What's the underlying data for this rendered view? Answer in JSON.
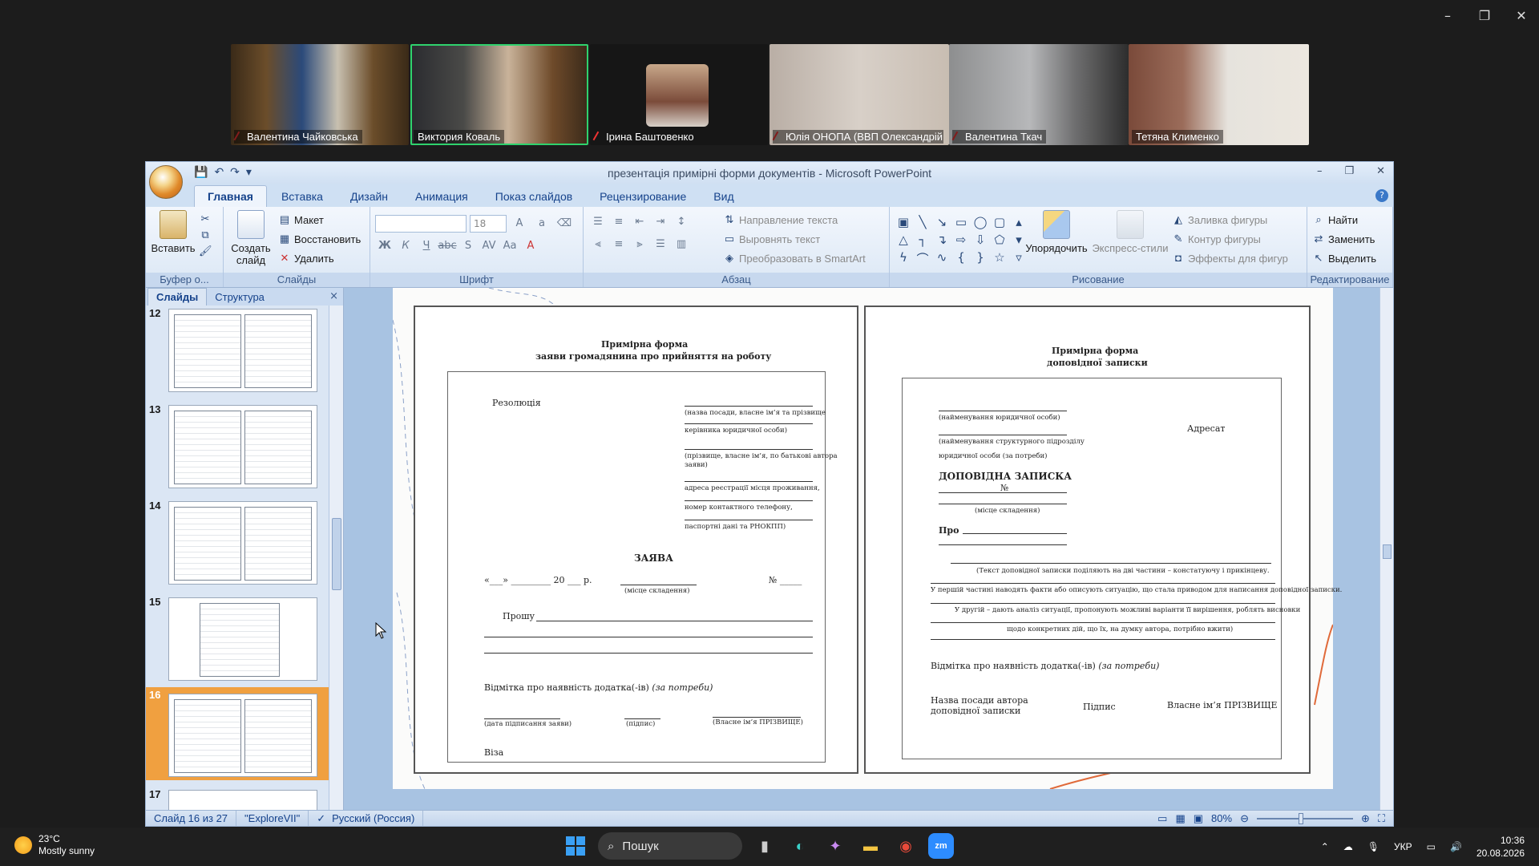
{
  "window_controls": {
    "minimize": "–",
    "restore": "❐",
    "close": "✕"
  },
  "participants": [
    {
      "name": "Валентина Чайковська",
      "muted": true,
      "active": false
    },
    {
      "name": "Виктория Коваль",
      "muted": false,
      "active": true
    },
    {
      "name": "Ірина Баштовенко",
      "muted": true,
      "active": false
    },
    {
      "name": "Юлія ОНОПА (ВВП Олександрій...",
      "muted": true,
      "active": false
    },
    {
      "name": "Валентина Ткач",
      "muted": true,
      "active": false
    },
    {
      "name": "Тетяна Клименко",
      "muted": false,
      "active": false
    }
  ],
  "ppt": {
    "title": "презентація примірні форми документів - Microsoft PowerPoint",
    "tabs": [
      "Главная",
      "Вставка",
      "Дизайн",
      "Анимация",
      "Показ слайдов",
      "Рецензирование",
      "Вид"
    ],
    "active_tab": "Главная",
    "ribbon": {
      "clipboard": {
        "paste": "Вставить",
        "label": "Буфер о..."
      },
      "slides": {
        "new_slide_1": "Создать",
        "new_slide_2": "слайд",
        "layout": "Макет",
        "reset": "Восстановить",
        "delete": "Удалить",
        "label": "Слайды"
      },
      "font": {
        "size": "18",
        "label": "Шрифт"
      },
      "paragraph": {
        "text_direction": "Направление текста",
        "align_text": "Выровнять текст",
        "smartart": "Преобразовать в SmartArt",
        "label": "Абзац"
      },
      "drawing": {
        "arrange": "Упорядочить",
        "quick_styles": "Экспресс-стили",
        "fill": "Заливка фигуры",
        "outline": "Контур фигуры",
        "effects": "Эффекты для фигур",
        "label": "Рисование"
      },
      "editing": {
        "find": "Найти",
        "replace": "Заменить",
        "select": "Выделить",
        "label": "Редактирование"
      }
    },
    "panel": {
      "tab_slides": "Слайды",
      "tab_outline": "Структура",
      "close": "×"
    },
    "slide_thumbs": [
      "12",
      "13",
      "14",
      "15",
      "16",
      "17"
    ],
    "selected_slide": "16",
    "status": {
      "slide": "Слайд 16 из 27",
      "theme": "\"ExploreVII\"",
      "language": "Русский (Россия)",
      "zoom": "80%"
    }
  },
  "doc_left": {
    "title1": "Примірна форма",
    "title2": "заяви громадянина про прийняття на роботу",
    "resolution": "Резолюція",
    "f1": "(назва посади, власне ім’я та прізвище",
    "f2": "керівника юридичної особи)",
    "f3": "(прізвище, власне ім’я, по батькові автора",
    "f3b": "заяви)",
    "f4": "адреса реєстрації місця проживання,",
    "f5": "номер контактного телефону,",
    "f6": "паспортні дані та РНОКПП)",
    "heading": "ЗАЯВА",
    "date": "«___» _________ 20 ___ р.",
    "num": "№ _____",
    "place": "(місце складення)",
    "request": "Прошу",
    "attachment": "Відмітка про наявність додатка(-ів)",
    "attachment_note": "(за потреби)",
    "sig_date": "(дата підписання заяви)",
    "sig": "(підпис)",
    "sig_name": "(Власне ім’я ПРІЗВИЩЕ)",
    "visa": "Віза"
  },
  "doc_right": {
    "title1": "Примірна форма",
    "title2": "доповідної записки",
    "r1": "(найменування юридичної особи)",
    "addressee": "Адресат",
    "r2": "(найменування структурного підрозділу",
    "r3": "юридичної особи (за потреби)",
    "heading": "ДОПОВІДНА ЗАПИСКА",
    "num": "№",
    "place": "(місце складення)",
    "about": "Про",
    "body1": "(Текст доповідної записки поділяють на дві частини – констатуючу і прикінцеву.",
    "body2": "У першій частині наводять факти або описують ситуацію, що стала приводом для написання доповідної записки.",
    "body3": "У другій – дають аналіз ситуації, пропонують можливі варіанти її вирішення, роблять висновки",
    "body4": "щодо конкретних дій, що їх, на думку автора, потрібно вжити)",
    "attachment": "Відмітка про наявність додатка(-ів)",
    "attachment_note": "(за потреби)",
    "author1": "Назва посади автора",
    "author2": "доповідної записки",
    "sig": "Підпис",
    "sig_name": "Власне ім’я ПРІЗВИЩЕ"
  },
  "taskbar": {
    "temp": "23°C",
    "weather": "Mostly sunny",
    "search": "Пошук",
    "lang": "УКР",
    "time": "10:36",
    "date": "20.08.2026"
  }
}
